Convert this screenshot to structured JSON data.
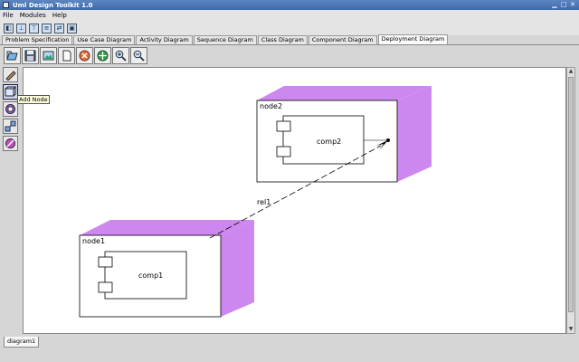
{
  "window": {
    "title": "Uml Design Toolkit 1.0"
  },
  "menu": [
    "File",
    "Modules",
    "Help"
  ],
  "iconbar": [
    "new-icon",
    "hierarchy-icon",
    "tree-icon",
    "database-icon",
    "transfer-icon",
    "window-icon"
  ],
  "tabs": [
    {
      "label": "Problem Specification",
      "active": false
    },
    {
      "label": "Use Case Diagram",
      "active": false
    },
    {
      "label": "Activity Diagram",
      "active": false
    },
    {
      "label": "Sequence Diagram",
      "active": false
    },
    {
      "label": "Class Diagram",
      "active": false
    },
    {
      "label": "Component Diagram",
      "active": false
    },
    {
      "label": "Deployment Diagram",
      "active": true
    }
  ],
  "tooltip": "Add Node",
  "diagram": {
    "nodes": [
      {
        "name": "node2",
        "component": "comp2"
      },
      {
        "name": "node1",
        "component": "comp1"
      }
    ],
    "relation": "rel1"
  },
  "bottom_tab": "diagram1",
  "colors": {
    "node_side": "#cc88ee",
    "titlebar": "#4a74b2",
    "canvas": "#ffffff"
  }
}
